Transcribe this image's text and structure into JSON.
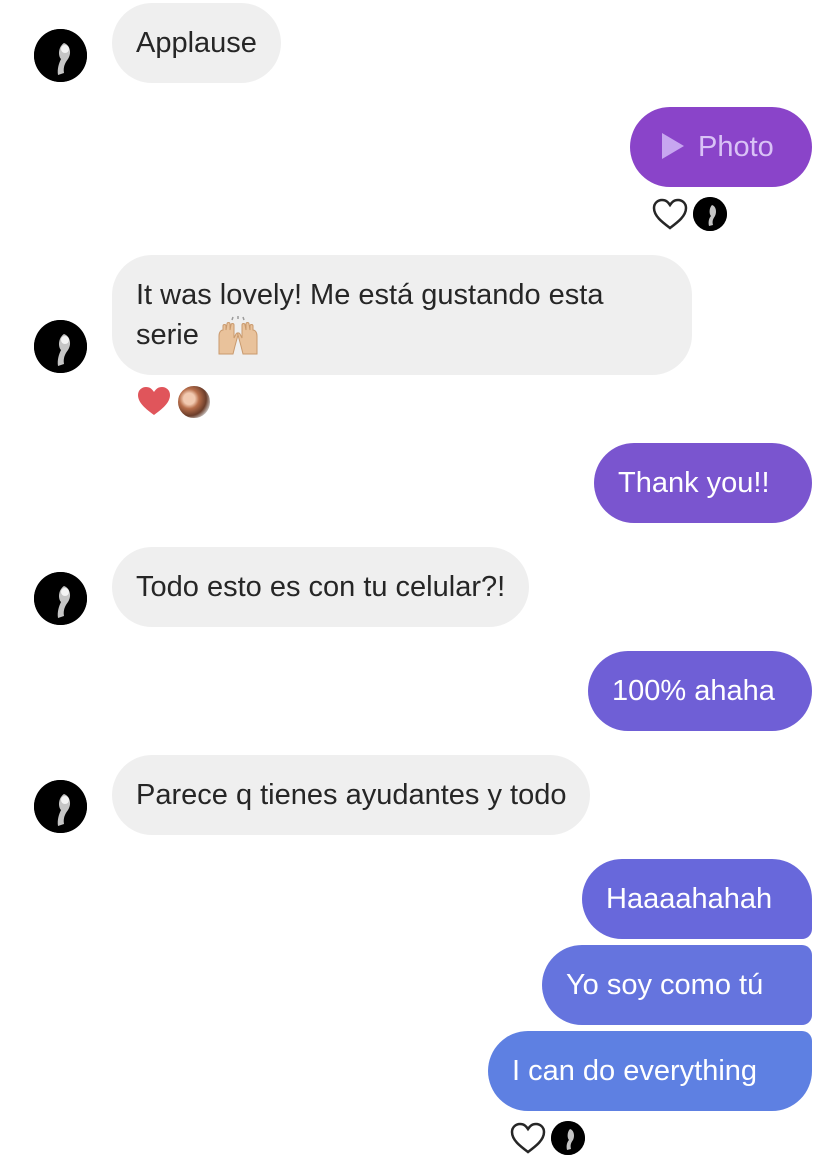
{
  "messages": {
    "m1": "Applause",
    "m2": "Photo",
    "m3_line1": "It was lovely! Me está gustando esta",
    "m3_line2": "serie",
    "m4": "Thank you!!",
    "m5": "Todo esto es con tu celular?!",
    "m6": "100% ahaha",
    "m7": "Parece q tienes ayudantes y todo",
    "m8": "Haaaahahah",
    "m9": "Yo soy como tú",
    "m10": "I can do everything"
  },
  "icons": {
    "play": "play-icon",
    "heart_outline": "heart-outline-icon",
    "heart_filled": "heart-filled-icon",
    "raised_hands_emoji": "raised-hands-emoji"
  },
  "colors": {
    "incoming_bubble": "#efefef",
    "photo_bubble": "#8a44c9",
    "heart_filled": "#e0555b"
  }
}
